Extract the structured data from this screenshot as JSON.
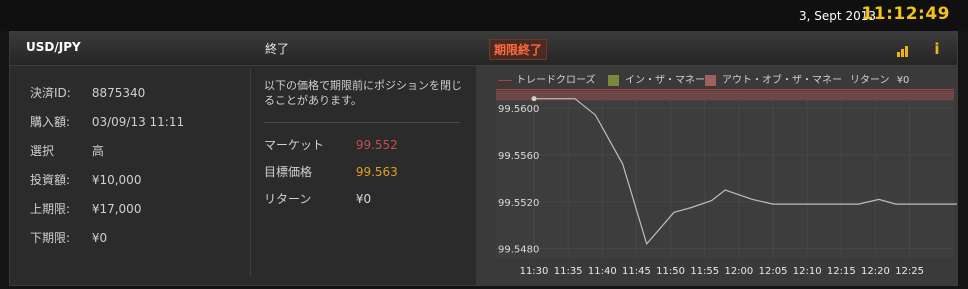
{
  "header": {
    "date": "3, Sept 2013",
    "time": "11:12:49"
  },
  "trade": {
    "pair": "USD/JPY",
    "status": "終了",
    "expired_badge": "期限終了",
    "details": [
      {
        "label": "決済ID:",
        "value": "8875340"
      },
      {
        "label": "購入額:",
        "value": "03/09/13 11:11"
      },
      {
        "label": "選択",
        "value": "高"
      },
      {
        "label": "投資額:",
        "value": "¥10,000"
      },
      {
        "label": "上期限:",
        "value": "¥17,000"
      },
      {
        "label": "下期限:",
        "value": "¥0"
      }
    ],
    "note": "以下の価格で期限前にポジションを閉じることがあります。",
    "market": {
      "label": "マーケット",
      "value": "99.552"
    },
    "target": {
      "label": "目標価格",
      "value": "99.563"
    },
    "return": {
      "label": "リターン",
      "value": "¥0"
    }
  },
  "legend": {
    "trade_close": "トレードクローズ",
    "in_the_money": "イン・ザ・マネー",
    "out_of_the_money": "アウト・オブ・ザ・マネー",
    "return_label": "リターン",
    "return_value": "¥0"
  },
  "colors": {
    "accent": "#f2c31a",
    "market_value": "#c0504d",
    "target_value": "#e0a020",
    "in_money": "#7a8a3a",
    "out_money": "#a06060",
    "trade_close_line": "#b04040",
    "price_line": "#bdbdbd"
  },
  "icons": [
    "signal-bars-icon",
    "info-icon"
  ],
  "chart_data": {
    "type": "line",
    "x": [
      "11:30",
      "11:35",
      "11:40",
      "11:45",
      "11:50",
      "11:55",
      "12:00",
      "12:05",
      "12:10",
      "12:15",
      "12:20",
      "12:25"
    ],
    "y_ticks": [
      "99.5600",
      "99.5560",
      "99.5520",
      "99.5480"
    ],
    "ylim": [
      99.5472,
      99.5612
    ],
    "series": [
      {
        "name": "",
        "points": [
          [
            0,
            99.5608
          ],
          [
            1.2,
            99.5608
          ],
          [
            1.8,
            99.5594
          ],
          [
            2.6,
            99.5552
          ],
          [
            3.3,
            99.5484
          ],
          [
            4.1,
            99.5511
          ],
          [
            4.6,
            99.5515
          ],
          [
            5.2,
            99.5521
          ],
          [
            5.6,
            99.553
          ],
          [
            6.4,
            99.5522
          ],
          [
            7.0,
            99.5518
          ],
          [
            8.0,
            99.5518
          ],
          [
            9.0,
            99.5518
          ],
          [
            9.5,
            99.5518
          ],
          [
            10.1,
            99.5522
          ],
          [
            10.6,
            99.5518
          ],
          [
            11.3,
            99.5518
          ],
          [
            12.4,
            99.5518
          ]
        ]
      }
    ],
    "out_of_money_band": [
      99.561,
      99.5615
    ]
  }
}
